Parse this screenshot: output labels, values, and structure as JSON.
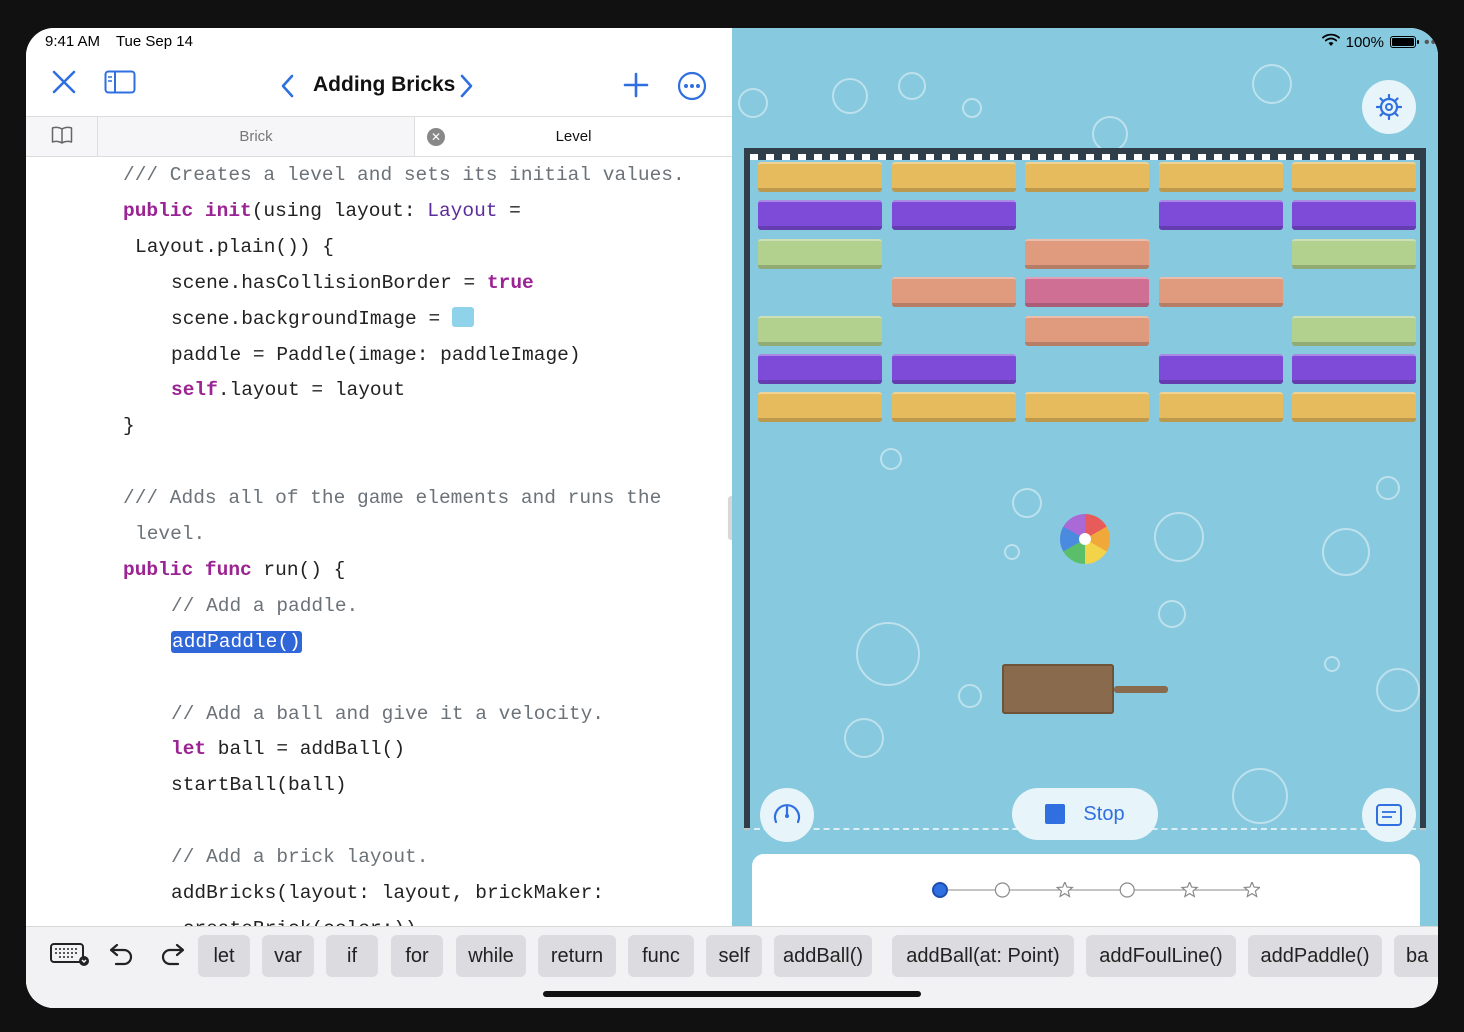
{
  "status": {
    "time": "9:41 AM",
    "date": "Tue Sep 14",
    "battery": "100%",
    "battery_level": 1.0
  },
  "nav": {
    "title": "Adding Bricks"
  },
  "tabs": [
    {
      "label": "Brick"
    },
    {
      "label": "Level"
    }
  ],
  "code": [
    {
      "indent": 0,
      "tokens": [
        {
          "c": "cm",
          "t": "/// Creates a level and sets its initial values."
        }
      ]
    },
    {
      "indent": 0,
      "tokens": [
        {
          "c": "kw",
          "t": "public"
        },
        {
          "c": "",
          "t": " "
        },
        {
          "c": "kw",
          "t": "init"
        },
        {
          "c": "",
          "t": "(using layout: "
        },
        {
          "c": "ty",
          "t": "Layout"
        },
        {
          "c": "",
          "t": " ="
        }
      ]
    },
    {
      "indent": 1,
      "tokens": [
        {
          "c": "",
          "t": "Layout.plain()) {"
        }
      ]
    },
    {
      "indent": 4,
      "tokens": [
        {
          "c": "",
          "t": "scene.hasCollisionBorder = "
        },
        {
          "c": "kw",
          "t": "true"
        }
      ]
    },
    {
      "indent": 4,
      "tokens": [
        {
          "c": "",
          "t": "scene.backgroundImage = "
        },
        {
          "c": "swatch",
          "t": ""
        }
      ]
    },
    {
      "indent": 4,
      "tokens": [
        {
          "c": "",
          "t": "paddle = Paddle(image: paddleImage)"
        }
      ]
    },
    {
      "indent": 4,
      "tokens": [
        {
          "c": "kw",
          "t": "self"
        },
        {
          "c": "",
          "t": ".layout = layout"
        }
      ]
    },
    {
      "indent": 0,
      "tokens": [
        {
          "c": "",
          "t": "}"
        }
      ]
    },
    {
      "indent": 0,
      "tokens": []
    },
    {
      "indent": 0,
      "tokens": [
        {
          "c": "cm",
          "t": "/// Adds all of the game elements and runs the"
        }
      ]
    },
    {
      "indent": 1,
      "tokens": [
        {
          "c": "cm",
          "t": "level."
        }
      ]
    },
    {
      "indent": 0,
      "tokens": [
        {
          "c": "kw",
          "t": "public"
        },
        {
          "c": "",
          "t": " "
        },
        {
          "c": "kw",
          "t": "func"
        },
        {
          "c": "",
          "t": " run() {"
        }
      ]
    },
    {
      "indent": 4,
      "tokens": [
        {
          "c": "cm",
          "t": "// Add a paddle."
        }
      ]
    },
    {
      "indent": 4,
      "tokens": [
        {
          "c": "sel",
          "t": "addPaddle()"
        }
      ]
    },
    {
      "indent": 0,
      "tokens": []
    },
    {
      "indent": 4,
      "tokens": [
        {
          "c": "cm",
          "t": "// Add a ball and give it a velocity."
        }
      ]
    },
    {
      "indent": 4,
      "tokens": [
        {
          "c": "kw",
          "t": "let"
        },
        {
          "c": "",
          "t": " ball = addBall()"
        }
      ]
    },
    {
      "indent": 4,
      "tokens": [
        {
          "c": "",
          "t": "startBall(ball)"
        }
      ]
    },
    {
      "indent": 0,
      "tokens": []
    },
    {
      "indent": 4,
      "tokens": [
        {
          "c": "cm",
          "t": "// Add a brick layout."
        }
      ]
    },
    {
      "indent": 4,
      "tokens": [
        {
          "c": "",
          "t": "addBricks(layout: layout, brickMaker:"
        }
      ]
    },
    {
      "indent": 4,
      "tokens": [
        {
          "c": "",
          "t": " createBrick(color:))"
        }
      ]
    }
  ],
  "shortcuts": [
    "let",
    "var",
    "if",
    "for",
    "while",
    "return",
    "func",
    "self",
    "addBall()",
    "addBall(at: Point)",
    "addFoulLine()",
    "addPaddle()",
    "ba"
  ],
  "game": {
    "run_button_label": "Stop",
    "colors": {
      "yellow": "#e6bb5d",
      "purple": "#7d4bd8",
      "green": "#b2d08e",
      "salmon": "#e09a7e",
      "pink": "#cf6f93"
    },
    "brick_grid": [
      [
        "yellow",
        "yellow",
        "yellow",
        "yellow",
        "yellow"
      ],
      [
        "purple",
        "purple",
        "",
        "purple",
        "purple"
      ],
      [
        "green",
        "",
        "salmon",
        "",
        "green"
      ],
      [
        "",
        "salmon",
        "pink",
        "salmon",
        ""
      ],
      [
        "green",
        "",
        "salmon",
        "",
        "green"
      ],
      [
        "purple",
        "purple",
        "",
        "purple",
        "purple"
      ],
      [
        "yellow",
        "yellow",
        "yellow",
        "yellow",
        "yellow"
      ]
    ],
    "progress_steps": [
      "current",
      "circle",
      "star",
      "circle",
      "star",
      "star"
    ]
  }
}
